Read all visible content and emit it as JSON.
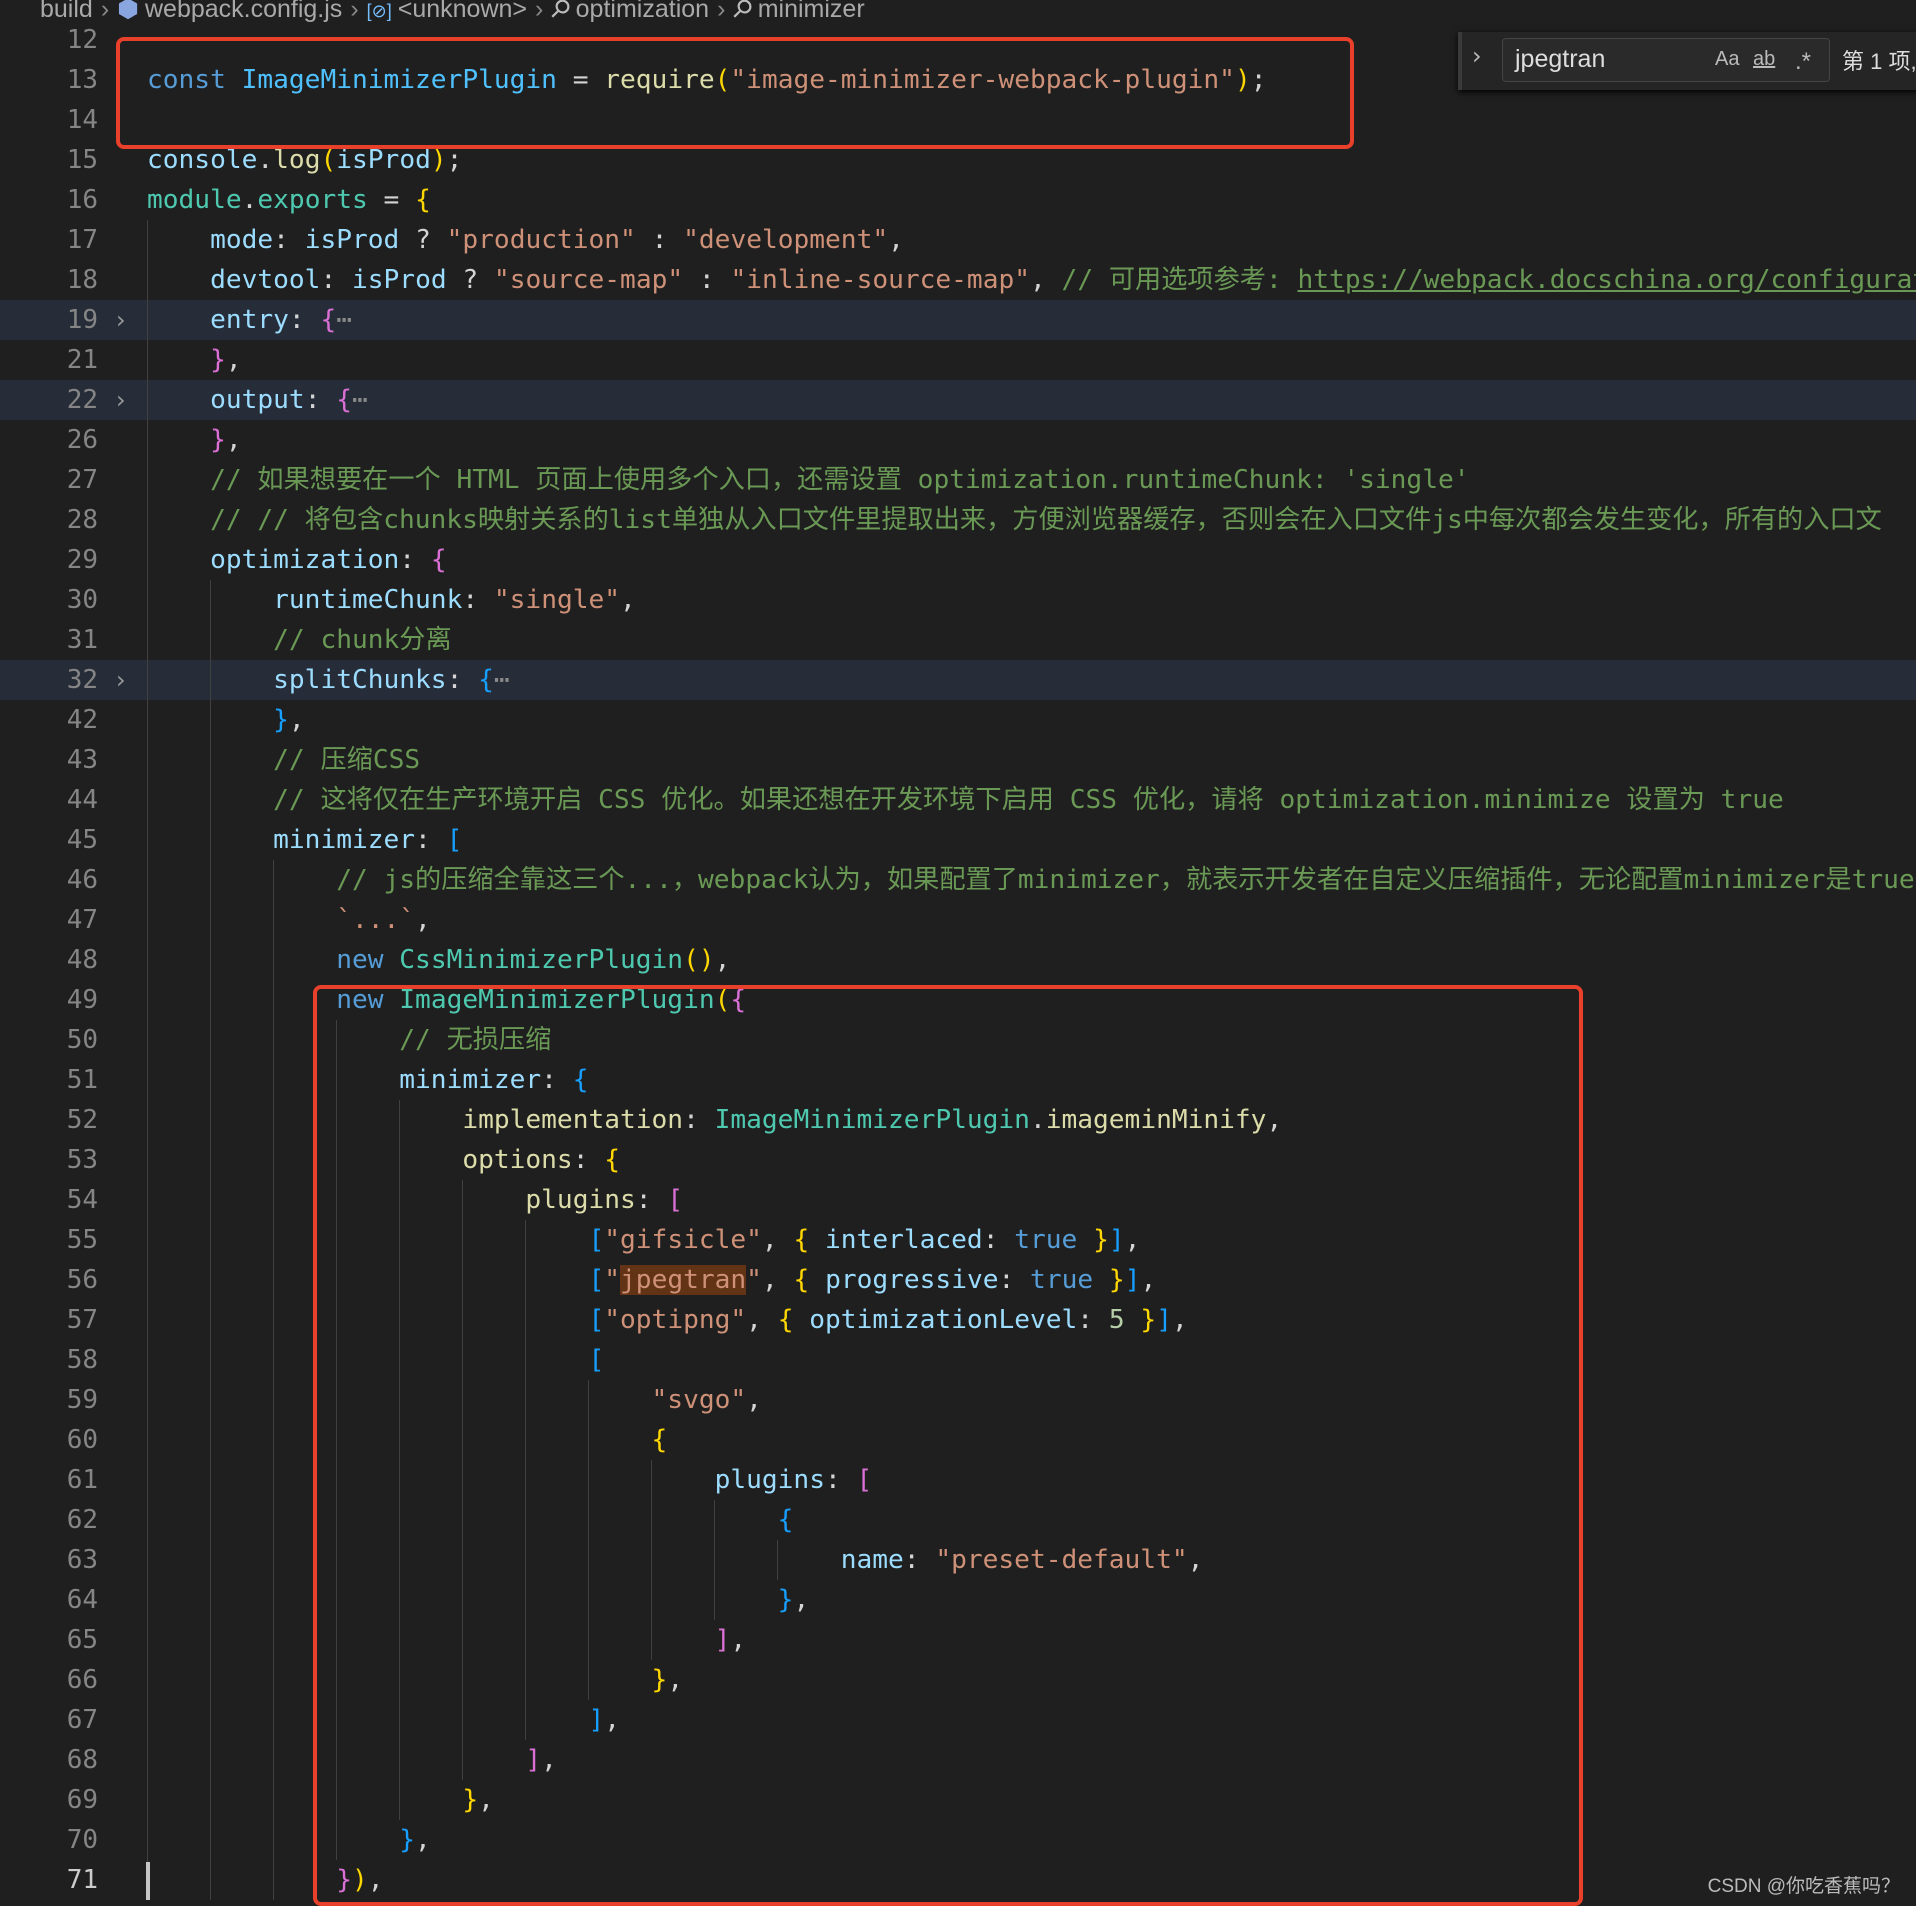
{
  "breadcrumb": [
    {
      "label": "build",
      "icon": ""
    },
    {
      "label": "webpack.config.js",
      "icon": "js-file-icon"
    },
    {
      "label": "<unknown>",
      "icon": "variable-icon"
    },
    {
      "label": "optimization",
      "icon": "wrench-icon"
    },
    {
      "label": "minimizer",
      "icon": "wrench-icon"
    }
  ],
  "find_widget": {
    "value": "jpegtran",
    "match_case": "Aa",
    "whole_word": "ab",
    "regex": ".*",
    "count": "第 1 项,"
  },
  "watermark": "CSDN @你吃香蕉吗？",
  "colors": {
    "highlight_box": "#e8402a",
    "editor_bg": "#1f1f1f",
    "search_match": "#623315"
  },
  "active_line": 71,
  "lines": [
    {
      "n": 12,
      "t": []
    },
    {
      "n": 13,
      "t": [
        [
          "k",
          "const "
        ],
        [
          "o",
          "ImageMinimizerPlugin"
        ],
        [
          "p",
          " = "
        ],
        [
          "f",
          "require"
        ],
        [
          "b1",
          "("
        ],
        [
          "s",
          "\"image-minimizer-webpack-plugin\""
        ],
        [
          "b1",
          ")"
        ],
        [
          "p",
          ";"
        ]
      ]
    },
    {
      "n": 14,
      "t": []
    },
    {
      "n": 15,
      "t": [
        [
          "v",
          "console"
        ],
        [
          "p",
          "."
        ],
        [
          "f",
          "log"
        ],
        [
          "b1",
          "("
        ],
        [
          "v",
          "isProd"
        ],
        [
          "b1",
          ")"
        ],
        [
          "p",
          ";"
        ]
      ]
    },
    {
      "n": 16,
      "t": [
        [
          "c",
          "module"
        ],
        [
          "p",
          "."
        ],
        [
          "c",
          "exports"
        ],
        [
          "p",
          " = "
        ],
        [
          "b1",
          "{"
        ]
      ]
    },
    {
      "n": 17,
      "t": [
        [
          "p",
          "    "
        ],
        [
          "v",
          "mode"
        ],
        [
          "p",
          ": "
        ],
        [
          "v",
          "isProd"
        ],
        [
          "p",
          " ? "
        ],
        [
          "s",
          "\"production\""
        ],
        [
          "p",
          " : "
        ],
        [
          "s",
          "\"development\""
        ],
        [
          "p",
          ","
        ]
      ]
    },
    {
      "n": 18,
      "t": [
        [
          "p",
          "    "
        ],
        [
          "v",
          "devtool"
        ],
        [
          "p",
          ": "
        ],
        [
          "v",
          "isProd"
        ],
        [
          "p",
          " ? "
        ],
        [
          "s",
          "\"source-map\""
        ],
        [
          "p",
          " : "
        ],
        [
          "s",
          "\"inline-source-map\""
        ],
        [
          "p",
          ", "
        ],
        [
          "m",
          "// 可用选项参考: "
        ],
        [
          "u",
          "https://webpack.docschina.org/configuration/devtool/"
        ]
      ]
    },
    {
      "n": 19,
      "fold": true,
      "t": [
        [
          "p",
          "    "
        ],
        [
          "v",
          "entry"
        ],
        [
          "p",
          ": "
        ],
        [
          "b2",
          "{"
        ],
        [
          "e",
          "⋯"
        ]
      ]
    },
    {
      "n": 21,
      "t": [
        [
          "p",
          "    "
        ],
        [
          "b2",
          "}"
        ],
        [
          "p",
          ","
        ]
      ]
    },
    {
      "n": 22,
      "fold": true,
      "t": [
        [
          "p",
          "    "
        ],
        [
          "v",
          "output"
        ],
        [
          "p",
          ": "
        ],
        [
          "b2",
          "{"
        ],
        [
          "e",
          "⋯"
        ]
      ]
    },
    {
      "n": 26,
      "t": [
        [
          "p",
          "    "
        ],
        [
          "b2",
          "}"
        ],
        [
          "p",
          ","
        ]
      ]
    },
    {
      "n": 27,
      "t": [
        [
          "p",
          "    "
        ],
        [
          "m",
          "// 如果想要在一个 HTML 页面上使用多个入口，还需设置 optimization.runtimeChunk: 'single'"
        ]
      ]
    },
    {
      "n": 28,
      "t": [
        [
          "p",
          "    "
        ],
        [
          "m",
          "// // 将包含chunks映射关系的list单独从入口文件里提取出来，方便浏览器缓存，否则会在入口文件js中每次都会发生变化，所有的入口文"
        ]
      ]
    },
    {
      "n": 29,
      "t": [
        [
          "p",
          "    "
        ],
        [
          "v",
          "optimization"
        ],
        [
          "p",
          ": "
        ],
        [
          "b2",
          "{"
        ]
      ]
    },
    {
      "n": 30,
      "t": [
        [
          "p",
          "        "
        ],
        [
          "v",
          "runtimeChunk"
        ],
        [
          "p",
          ": "
        ],
        [
          "s",
          "\"single\""
        ],
        [
          "p",
          ","
        ]
      ]
    },
    {
      "n": 31,
      "t": [
        [
          "p",
          "        "
        ],
        [
          "m",
          "// chunk分离"
        ]
      ]
    },
    {
      "n": 32,
      "fold": true,
      "t": [
        [
          "p",
          "        "
        ],
        [
          "v",
          "splitChunks"
        ],
        [
          "p",
          ": "
        ],
        [
          "b3",
          "{"
        ],
        [
          "e",
          "⋯"
        ]
      ]
    },
    {
      "n": 42,
      "t": [
        [
          "p",
          "        "
        ],
        [
          "b3",
          "}"
        ],
        [
          "p",
          ","
        ]
      ]
    },
    {
      "n": 43,
      "t": [
        [
          "p",
          "        "
        ],
        [
          "m",
          "// 压缩CSS"
        ]
      ]
    },
    {
      "n": 44,
      "t": [
        [
          "p",
          "        "
        ],
        [
          "m",
          "// 这将仅在生产环境开启 CSS 优化。如果还想在开发环境下启用 CSS 优化，请将 optimization.minimize 设置为 true"
        ]
      ]
    },
    {
      "n": 45,
      "t": [
        [
          "p",
          "        "
        ],
        [
          "v",
          "minimizer"
        ],
        [
          "p",
          ": "
        ],
        [
          "b3",
          "["
        ]
      ]
    },
    {
      "n": 46,
      "t": [
        [
          "p",
          "            "
        ],
        [
          "m",
          "// js的压缩全靠这三个...，webpack认为，如果配置了minimizer，就表示开发者在自定义压缩插件，无论配置minimizer是true"
        ]
      ]
    },
    {
      "n": 47,
      "t": [
        [
          "p",
          "            "
        ],
        [
          "s",
          "`...`"
        ],
        [
          "p",
          ","
        ]
      ]
    },
    {
      "n": 48,
      "t": [
        [
          "p",
          "            "
        ],
        [
          "k",
          "new "
        ],
        [
          "c",
          "CssMinimizerPlugin"
        ],
        [
          "b1",
          "()"
        ],
        [
          "p",
          ","
        ]
      ]
    },
    {
      "n": 49,
      "t": [
        [
          "p",
          "            "
        ],
        [
          "k",
          "new "
        ],
        [
          "c",
          "ImageMinimizerPlugin"
        ],
        [
          "b1",
          "("
        ],
        [
          "b2",
          "{"
        ]
      ]
    },
    {
      "n": 50,
      "t": [
        [
          "p",
          "                "
        ],
        [
          "m",
          "// 无损压缩"
        ]
      ]
    },
    {
      "n": 51,
      "t": [
        [
          "p",
          "                "
        ],
        [
          "v",
          "minimizer"
        ],
        [
          "p",
          ": "
        ],
        [
          "b3",
          "{"
        ]
      ]
    },
    {
      "n": 52,
      "t": [
        [
          "p",
          "                    "
        ],
        [
          "f",
          "implementation"
        ],
        [
          "p",
          ": "
        ],
        [
          "c",
          "ImageMinimizerPlugin"
        ],
        [
          "p",
          "."
        ],
        [
          "f",
          "imageminMinify"
        ],
        [
          "p",
          ","
        ]
      ]
    },
    {
      "n": 53,
      "t": [
        [
          "p",
          "                    "
        ],
        [
          "f",
          "options"
        ],
        [
          "p",
          ": "
        ],
        [
          "b1",
          "{"
        ]
      ]
    },
    {
      "n": 54,
      "t": [
        [
          "p",
          "                        "
        ],
        [
          "f",
          "plugins"
        ],
        [
          "p",
          ": "
        ],
        [
          "b2",
          "["
        ]
      ]
    },
    {
      "n": 55,
      "t": [
        [
          "p",
          "                            "
        ],
        [
          "b3",
          "["
        ],
        [
          "s",
          "\"gifsicle\""
        ],
        [
          "p",
          ", "
        ],
        [
          "b1",
          "{"
        ],
        [
          "p",
          " "
        ],
        [
          "v",
          "interlaced"
        ],
        [
          "p",
          ": "
        ],
        [
          "k",
          "true"
        ],
        [
          "p",
          " "
        ],
        [
          "b1",
          "}"
        ],
        [
          "b3",
          "]"
        ],
        [
          "p",
          ","
        ]
      ]
    },
    {
      "n": 56,
      "t": [
        [
          "p",
          "                            "
        ],
        [
          "b3",
          "["
        ],
        [
          "s",
          "\""
        ],
        [
          "s hl",
          "jpegtran"
        ],
        [
          "s",
          "\""
        ],
        [
          "p",
          ", "
        ],
        [
          "b1",
          "{"
        ],
        [
          "p",
          " "
        ],
        [
          "v",
          "progressive"
        ],
        [
          "p",
          ": "
        ],
        [
          "k",
          "true"
        ],
        [
          "p",
          " "
        ],
        [
          "b1",
          "}"
        ],
        [
          "b3",
          "]"
        ],
        [
          "p",
          ","
        ]
      ]
    },
    {
      "n": 57,
      "t": [
        [
          "p",
          "                            "
        ],
        [
          "b3",
          "["
        ],
        [
          "s",
          "\"optipng\""
        ],
        [
          "p",
          ", "
        ],
        [
          "b1",
          "{"
        ],
        [
          "p",
          " "
        ],
        [
          "v",
          "optimizationLevel"
        ],
        [
          "p",
          ": "
        ],
        [
          "n",
          "5"
        ],
        [
          "p",
          " "
        ],
        [
          "b1",
          "}"
        ],
        [
          "b3",
          "]"
        ],
        [
          "p",
          ","
        ]
      ]
    },
    {
      "n": 58,
      "t": [
        [
          "p",
          "                            "
        ],
        [
          "b3",
          "["
        ]
      ]
    },
    {
      "n": 59,
      "t": [
        [
          "p",
          "                                "
        ],
        [
          "s",
          "\"svgo\""
        ],
        [
          "p",
          ","
        ]
      ]
    },
    {
      "n": 60,
      "t": [
        [
          "p",
          "                                "
        ],
        [
          "b1",
          "{"
        ]
      ]
    },
    {
      "n": 61,
      "t": [
        [
          "p",
          "                                    "
        ],
        [
          "v",
          "plugins"
        ],
        [
          "p",
          ": "
        ],
        [
          "b2",
          "["
        ]
      ]
    },
    {
      "n": 62,
      "t": [
        [
          "p",
          "                                        "
        ],
        [
          "b3",
          "{"
        ]
      ]
    },
    {
      "n": 63,
      "t": [
        [
          "p",
          "                                            "
        ],
        [
          "v",
          "name"
        ],
        [
          "p",
          ": "
        ],
        [
          "s",
          "\"preset-default\""
        ],
        [
          "p",
          ","
        ]
      ]
    },
    {
      "n": 64,
      "t": [
        [
          "p",
          "                                        "
        ],
        [
          "b3",
          "}"
        ],
        [
          "p",
          ","
        ]
      ]
    },
    {
      "n": 65,
      "t": [
        [
          "p",
          "                                    "
        ],
        [
          "b2",
          "]"
        ],
        [
          "p",
          ","
        ]
      ]
    },
    {
      "n": 66,
      "t": [
        [
          "p",
          "                                "
        ],
        [
          "b1",
          "}"
        ],
        [
          "p",
          ","
        ]
      ]
    },
    {
      "n": 67,
      "t": [
        [
          "p",
          "                            "
        ],
        [
          "b3",
          "]"
        ],
        [
          "p",
          ","
        ]
      ]
    },
    {
      "n": 68,
      "t": [
        [
          "p",
          "                        "
        ],
        [
          "b2",
          "]"
        ],
        [
          "p",
          ","
        ]
      ]
    },
    {
      "n": 69,
      "t": [
        [
          "p",
          "                    "
        ],
        [
          "b1",
          "}"
        ],
        [
          "p",
          ","
        ]
      ]
    },
    {
      "n": 70,
      "t": [
        [
          "p",
          "                "
        ],
        [
          "b3",
          "}"
        ],
        [
          "p",
          ","
        ]
      ]
    },
    {
      "n": 71,
      "t": [
        [
          "p",
          "            "
        ],
        [
          "b2",
          "}"
        ],
        [
          "b1",
          ")"
        ],
        [
          "p",
          ","
        ]
      ]
    }
  ]
}
